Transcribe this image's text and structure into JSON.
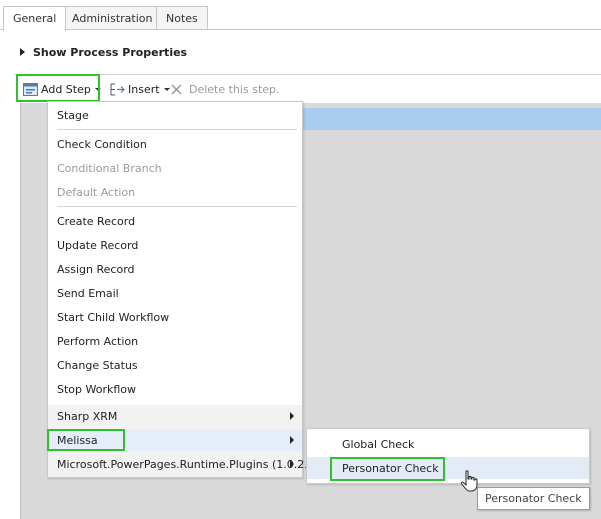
{
  "tabs": [
    {
      "label": "General",
      "active": true
    },
    {
      "label": "Administration",
      "active": false
    },
    {
      "label": "Notes",
      "active": false
    }
  ],
  "process_properties": {
    "label": "Show Process Properties",
    "expanded": false
  },
  "toolbar": {
    "add_step": "Add Step",
    "insert": "Insert",
    "delete": "Delete this step."
  },
  "add_step_menu": {
    "group1": [
      "Stage"
    ],
    "group2": [
      "Check Condition",
      "Conditional Branch",
      "Default Action"
    ],
    "group2_disabled": [
      "Conditional Branch",
      "Default Action"
    ],
    "group3": [
      "Create Record",
      "Update Record",
      "Assign Record",
      "Send Email",
      "Start Child Workflow",
      "Perform Action",
      "Change Status",
      "Stop Workflow"
    ],
    "submenus": [
      "Sharp XRM",
      "Melissa",
      "Microsoft.PowerPages.Runtime.Plugins (1.0.2..."
    ]
  },
  "melissa_submenu": [
    "Global Check",
    "Personator Check"
  ],
  "tooltip": "Personator Check",
  "colors": {
    "highlight_box": "#2ec22e",
    "selection_bar": "#a9ccef",
    "canvas": "#d9d9da"
  }
}
